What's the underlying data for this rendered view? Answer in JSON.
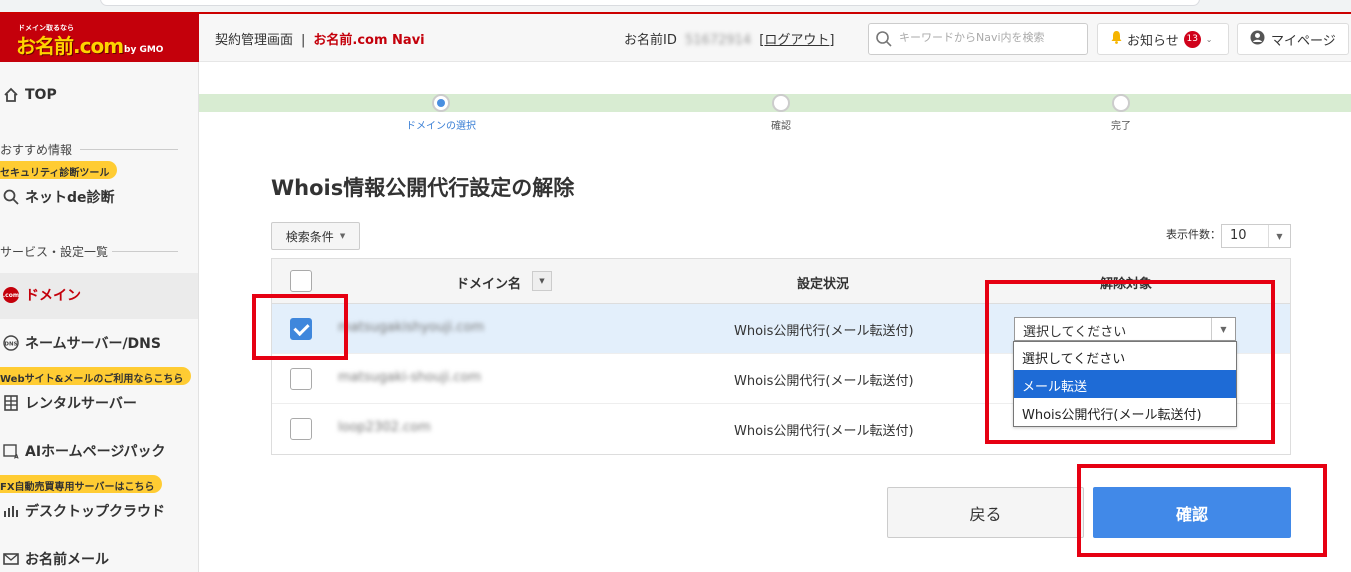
{
  "brand": {
    "logo_tagline": "ドメイン取るなら",
    "logo_text": "お名前.com",
    "logo_suffix": "by GMO"
  },
  "sidebar": {
    "top": "TOP",
    "section_recommend": "おすすめ情報",
    "tag_security": "セキュリティ診断ツール",
    "net_diagnosis": "ネットde診断",
    "section_services": "サービス・設定一覧",
    "domain": "ドメイン",
    "nameserver": "ネームサーバー/DNS",
    "tag_web_mail": "Webサイト&メールのご利用ならこちら",
    "rental_server": "レンタルサーバー",
    "ai_homepage": "AIホームページパック",
    "tag_fx": "FX自動売買専用サーバーはこちら",
    "desktop_cloud": "デスクトップクラウド",
    "onamae_mail": "お名前メール"
  },
  "header": {
    "section": "契約管理画面",
    "separator": "|",
    "brand": "お名前.com Navi",
    "id_label": "お名前ID",
    "id_value": "51672914",
    "logout": "ログアウト",
    "search_placeholder": "キーワードからNavi内を検索",
    "notice": "お知らせ",
    "notice_count": "13",
    "mypage": "マイページ"
  },
  "stepper": [
    "ドメインの選択",
    "確認",
    "完了"
  ],
  "page_title": "Whois情報公開代行設定の解除",
  "filter_button": "検索条件",
  "per_page_label": "表示件数：",
  "per_page_value": "10",
  "table": {
    "col_domain": "ドメイン名",
    "col_status": "設定状況",
    "col_target": "解除対象",
    "rows": [
      {
        "domain": "matsugakishyouji.com",
        "status": "Whois公開代行(メール転送付)",
        "target": "選択してください",
        "checked": true
      },
      {
        "domain": "matsugaki-shouji.com",
        "status": "Whois公開代行(メール転送付)",
        "target": "",
        "checked": false
      },
      {
        "domain": "loop2302.com",
        "status": "Whois公開代行(メール転送付)",
        "target": "",
        "checked": false
      }
    ]
  },
  "dropdown_options": [
    "選択してください",
    "メール転送",
    "Whois公開代行(メール転送付)"
  ],
  "buttons": {
    "back": "戻る",
    "confirm": "確認"
  },
  "colors": {
    "brand_red": "#c4000b",
    "primary_blue": "#4189e8",
    "highlight_red": "#e60012"
  }
}
